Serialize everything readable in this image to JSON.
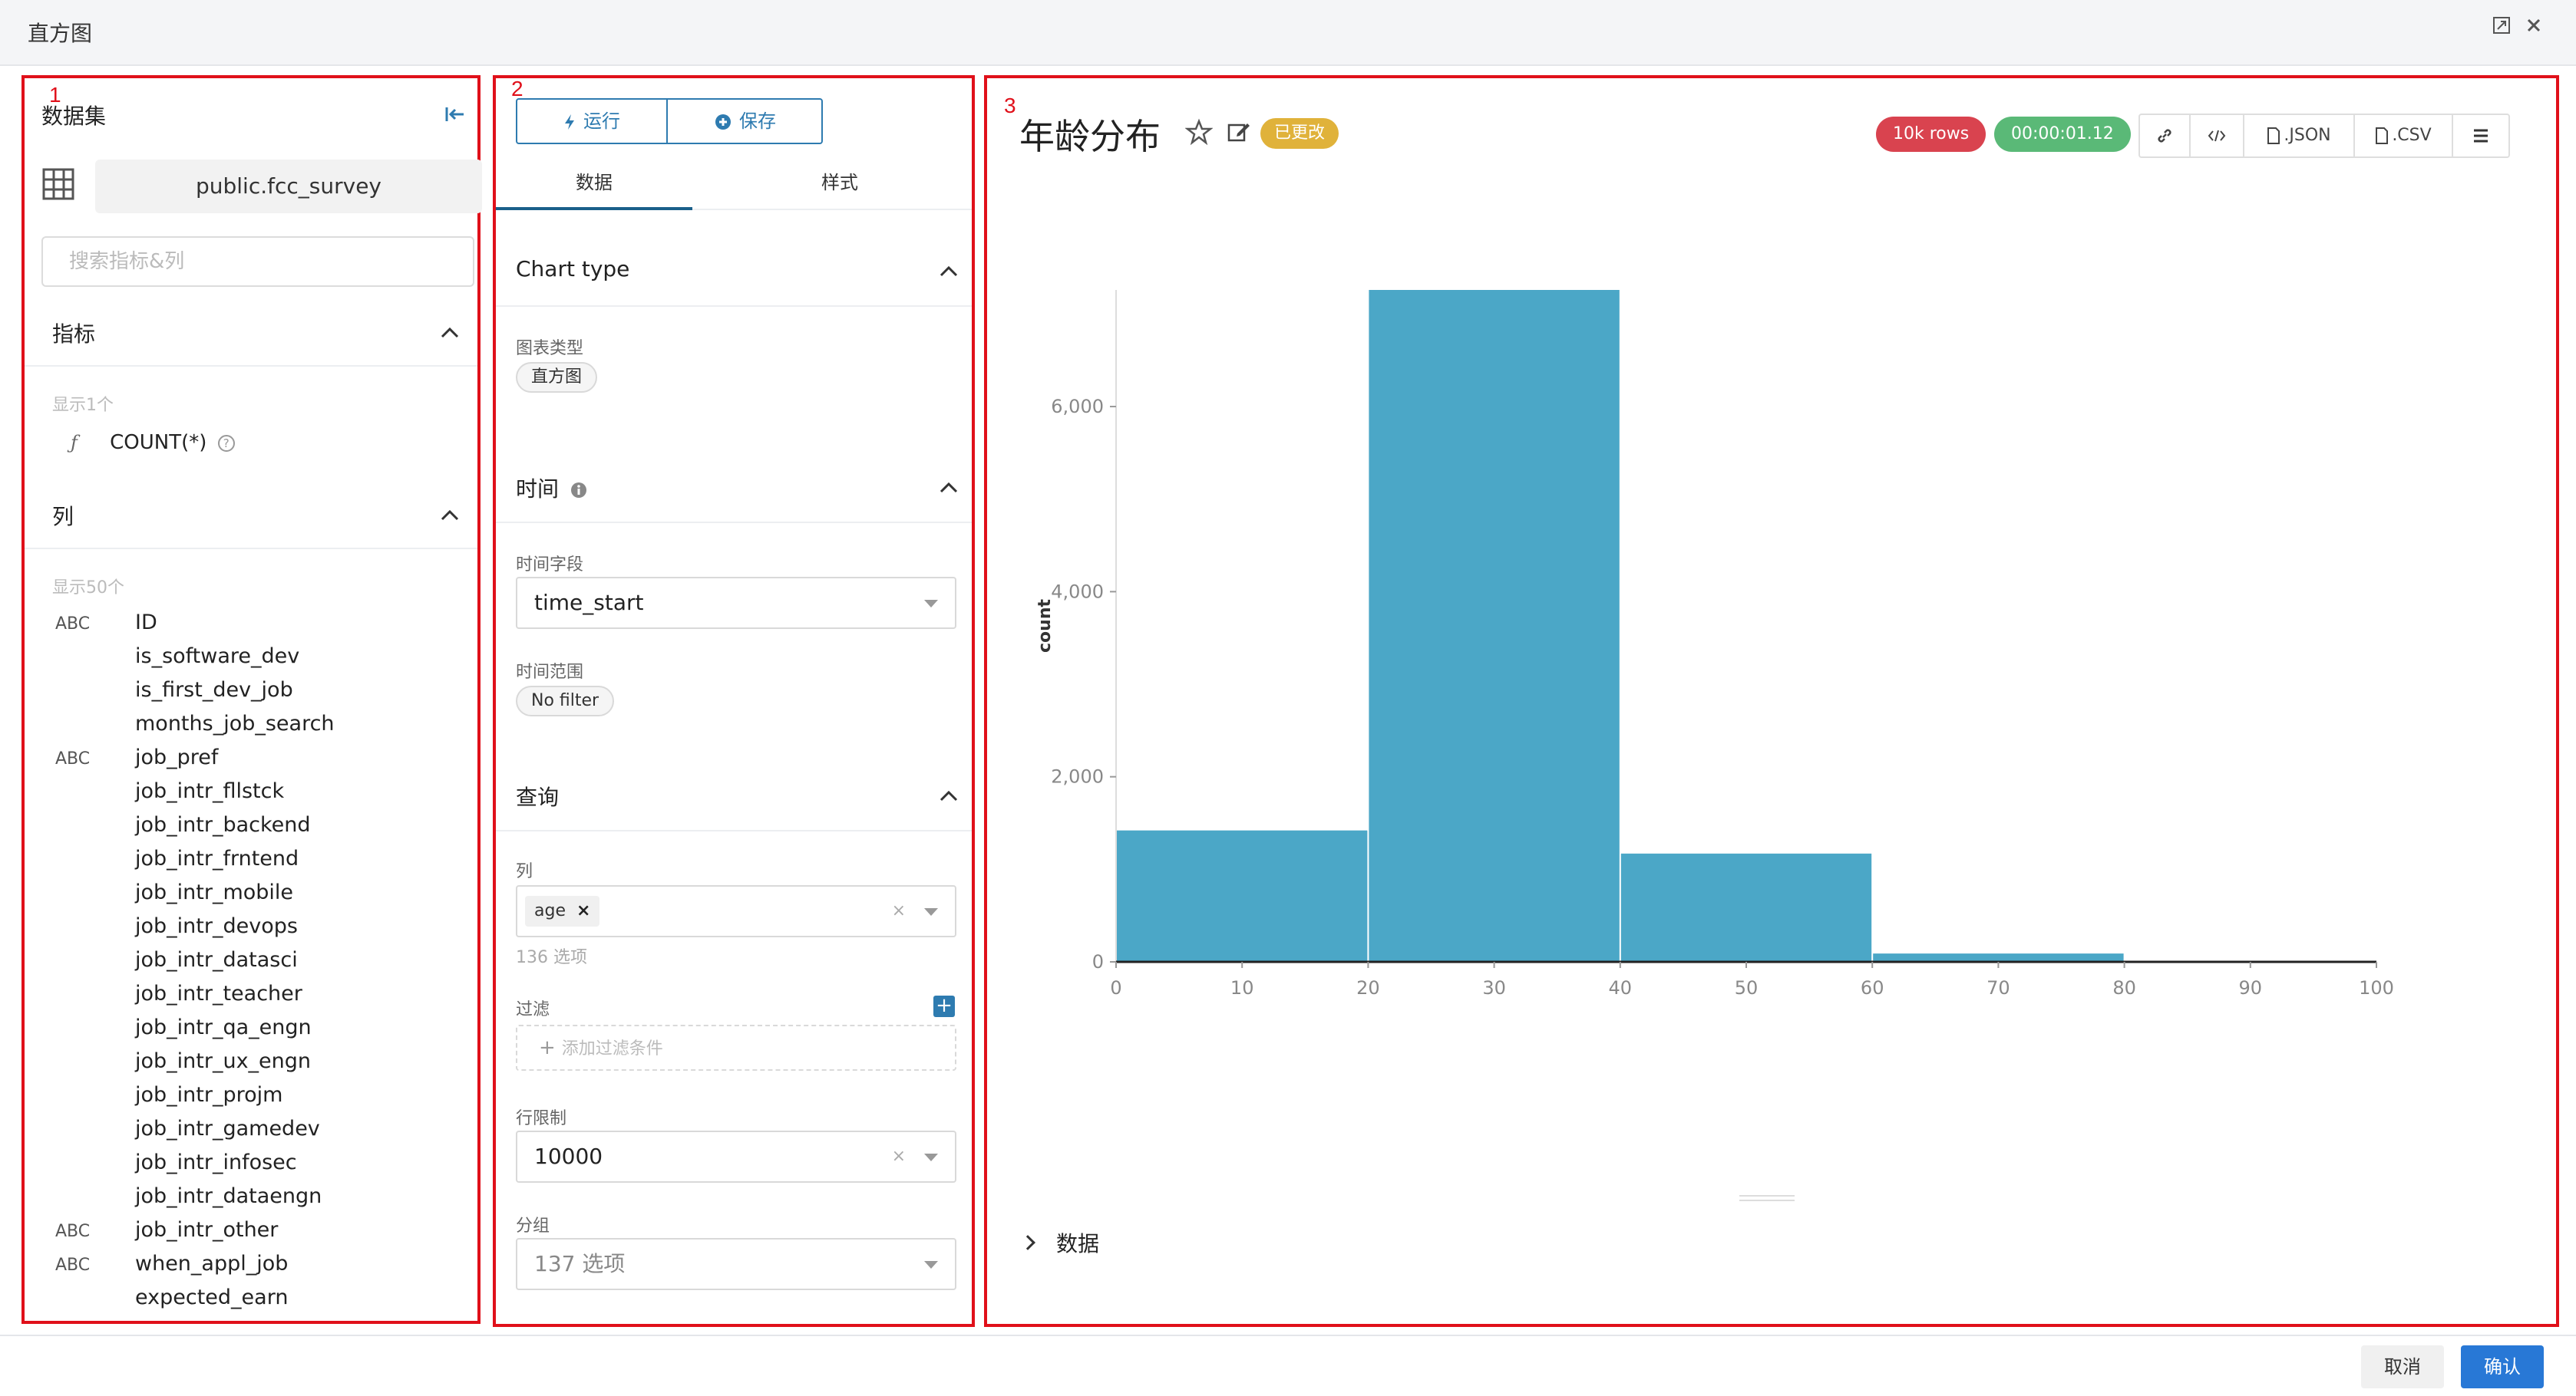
{
  "window": {
    "title": "直方图"
  },
  "panel_numbers": [
    "1",
    "2",
    "3"
  ],
  "datasource": {
    "header": "数据集",
    "name": "public.fcc_survey",
    "search_placeholder": "搜索指标&列"
  },
  "metrics": {
    "header": "指标",
    "count_text": "显示1个",
    "items": [
      {
        "icon": "ƒ",
        "name": "COUNT(*)"
      }
    ]
  },
  "columns": {
    "header": "列",
    "count_text": "显示50个",
    "items": [
      {
        "type": "ABC",
        "name": "ID"
      },
      {
        "type": "",
        "name": "is_software_dev"
      },
      {
        "type": "",
        "name": "is_first_dev_job"
      },
      {
        "type": "",
        "name": "months_job_search"
      },
      {
        "type": "ABC",
        "name": "job_pref"
      },
      {
        "type": "",
        "name": "job_intr_fllstck"
      },
      {
        "type": "",
        "name": "job_intr_backend"
      },
      {
        "type": "",
        "name": "job_intr_frntend"
      },
      {
        "type": "",
        "name": "job_intr_mobile"
      },
      {
        "type": "",
        "name": "job_intr_devops"
      },
      {
        "type": "",
        "name": "job_intr_datasci"
      },
      {
        "type": "",
        "name": "job_intr_teacher"
      },
      {
        "type": "",
        "name": "job_intr_qa_engn"
      },
      {
        "type": "",
        "name": "job_intr_ux_engn"
      },
      {
        "type": "",
        "name": "job_intr_projm"
      },
      {
        "type": "",
        "name": "job_intr_gamedev"
      },
      {
        "type": "",
        "name": "job_intr_infosec"
      },
      {
        "type": "",
        "name": "job_intr_dataengn"
      },
      {
        "type": "ABC",
        "name": "job_intr_other"
      },
      {
        "type": "ABC",
        "name": "when_appl_job"
      },
      {
        "type": "",
        "name": "expected_earn"
      }
    ]
  },
  "control": {
    "run_label": "运行",
    "save_label": "保存",
    "tabs": [
      "数据",
      "样式"
    ],
    "chart_type_header": "Chart type",
    "chart_type_label": "图表类型",
    "chart_type_value": "直方图",
    "time_header": "时间",
    "time_field_label": "时间字段",
    "time_field_value": "time_start",
    "time_range_label": "时间范围",
    "time_range_value": "No filter",
    "query_header": "查询",
    "columns_label": "列",
    "columns_tag": "age",
    "columns_options": "136 选项",
    "filter_label": "过滤",
    "filter_placeholder": "添加过滤条件",
    "row_limit_label": "行限制",
    "row_limit_value": "10000",
    "groupby_label": "分组",
    "groupby_placeholder": "137 选项"
  },
  "chart_panel": {
    "title": "年龄分布",
    "changed_badge": "已更改",
    "rows_badge": "10k rows",
    "time_badge": "00:00:01.12",
    "tools": [
      "link-icon",
      "code-icon",
      ".JSON",
      ".CSV",
      "menu-icon"
    ],
    "data_toggle": "数据"
  },
  "chart_data": {
    "type": "bar",
    "ylabel": "count",
    "xlabel": "",
    "bins": [
      {
        "x0": 0,
        "x1": 20,
        "value": 1420
      },
      {
        "x0": 20,
        "x1": 40,
        "value": 7260
      },
      {
        "x0": 40,
        "x1": 60,
        "value": 1170
      },
      {
        "x0": 60,
        "x1": 80,
        "value": 90
      },
      {
        "x0": 80,
        "x1": 100,
        "value": 8
      }
    ],
    "xlim": [
      0,
      100
    ],
    "ylim": [
      0,
      7260
    ],
    "xticks": [
      0,
      10,
      20,
      30,
      40,
      50,
      60,
      70,
      80,
      90,
      100
    ],
    "yticks": [
      0,
      2000,
      4000,
      6000
    ],
    "ytick_labels": [
      "0",
      "2,000",
      "4,000",
      "6,000"
    ],
    "bar_color": "#4ba7c7",
    "grid": false
  },
  "footer": {
    "cancel_label": "取消",
    "ok_label": "确认"
  }
}
